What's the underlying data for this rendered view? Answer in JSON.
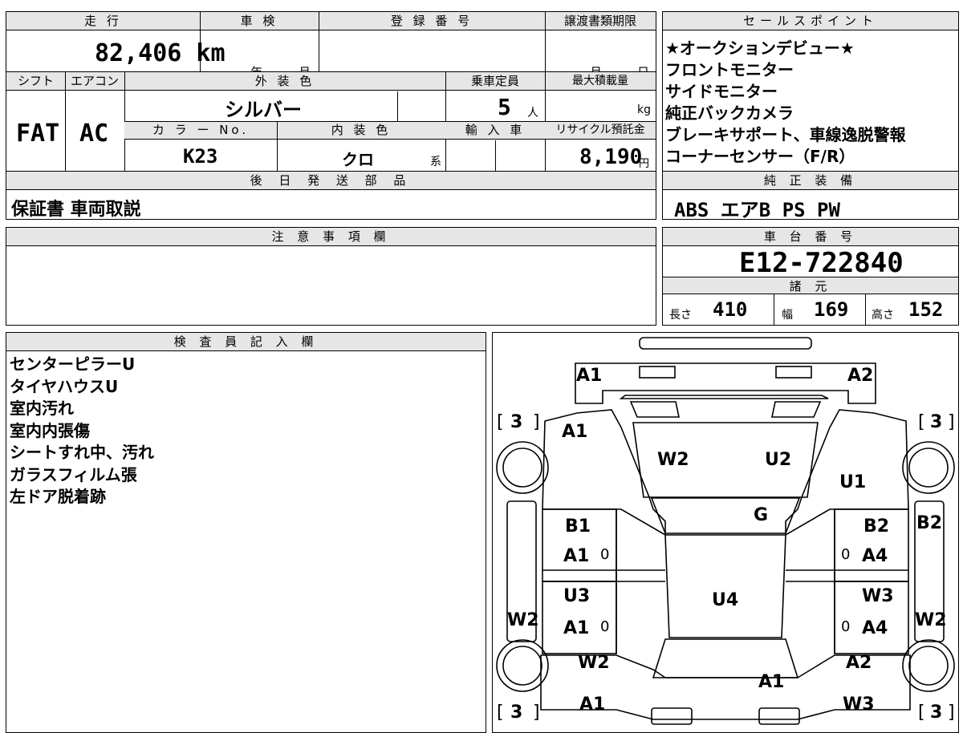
{
  "main": {
    "mileage_label": "走 行",
    "mileage": "82,406 km",
    "inspection_label": "車 検",
    "inspection_year": "年",
    "inspection_month": "月",
    "reg_label": "登 録 番 号",
    "transfer_label": "譲渡書類期限",
    "transfer_month": "月",
    "transfer_day": "日",
    "shift_label": "シフト",
    "ac_label": "エアコン",
    "ext_color_label": "外 装 色",
    "capacity_label": "乗車定員",
    "maxload_label": "最大積載量",
    "shift": "FAT",
    "ac": "AC",
    "ext_color": "シルバー",
    "capacity": "5",
    "capacity_unit": "人",
    "maxload_unit": "kg",
    "colorno_label": "カ ラ ー No.",
    "int_color_label": "内 装 色",
    "import_label": "輸 入 車",
    "recycle_label": "リサイクル預託金",
    "colorno": "K23",
    "int_color": "クロ",
    "int_color_unit": "系",
    "recycle": "8,190",
    "recycle_unit": "円",
    "later_label": "後 日 発 送 部 品",
    "later_items": "保証書 車両取説"
  },
  "sales": {
    "label": "セールスポイント",
    "items": [
      "★オークションデビュー★",
      "フロントモニター",
      "サイドモニター",
      "純正バックカメラ",
      "ブレーキサポート、車線逸脱警報",
      "コーナーセンサー（F/R）"
    ]
  },
  "equipment": {
    "label": "純 正 装 備",
    "value": "ABS エアB PS PW"
  },
  "notes": {
    "label": "注 意 事 項 欄"
  },
  "chassis": {
    "label": "車 台 番 号",
    "value": "E12-722840"
  },
  "specs": {
    "label": "諸 元",
    "length_label": "長さ",
    "length": "410",
    "width_label": "幅",
    "width": "169",
    "height_label": "高さ",
    "height": "152"
  },
  "inspector": {
    "label": "検 査 員 記 入 欄",
    "items": [
      "センターピラーU",
      "タイヤハウスU",
      "室内汚れ",
      "室内内張傷",
      "シートすれ中、汚れ",
      "ガラスフィルム張",
      "左ドア脱着跡"
    ]
  },
  "diagram": {
    "a1_front_left": "A1",
    "a2_front_right": "A2",
    "tire_fl": "3",
    "tire_fr": "3",
    "tire_rl": "3",
    "tire_rr": "3",
    "fender_left": "A1",
    "hood_left": "W2",
    "hood_right": "U2",
    "fender_right": "U1",
    "windshield": "G",
    "pillar_left": "B1",
    "pillar_right": "B2",
    "side_right": "B2",
    "front_door_left": "A1",
    "front_door_right": "A4",
    "zero1": "0",
    "zero2": "0",
    "rear_door_left_top": "U3",
    "roof": "U4",
    "rear_door_right_top": "W3",
    "rear_door_left": "A1",
    "rear_door_right": "A4",
    "zero3": "0",
    "zero4": "0",
    "sill_left": "W2",
    "sill_right": "W2",
    "rear_fender_left": "W2",
    "rear_fender_right": "A2",
    "trunk": "A1",
    "rear_left": "A1",
    "rear_right": "W3"
  }
}
